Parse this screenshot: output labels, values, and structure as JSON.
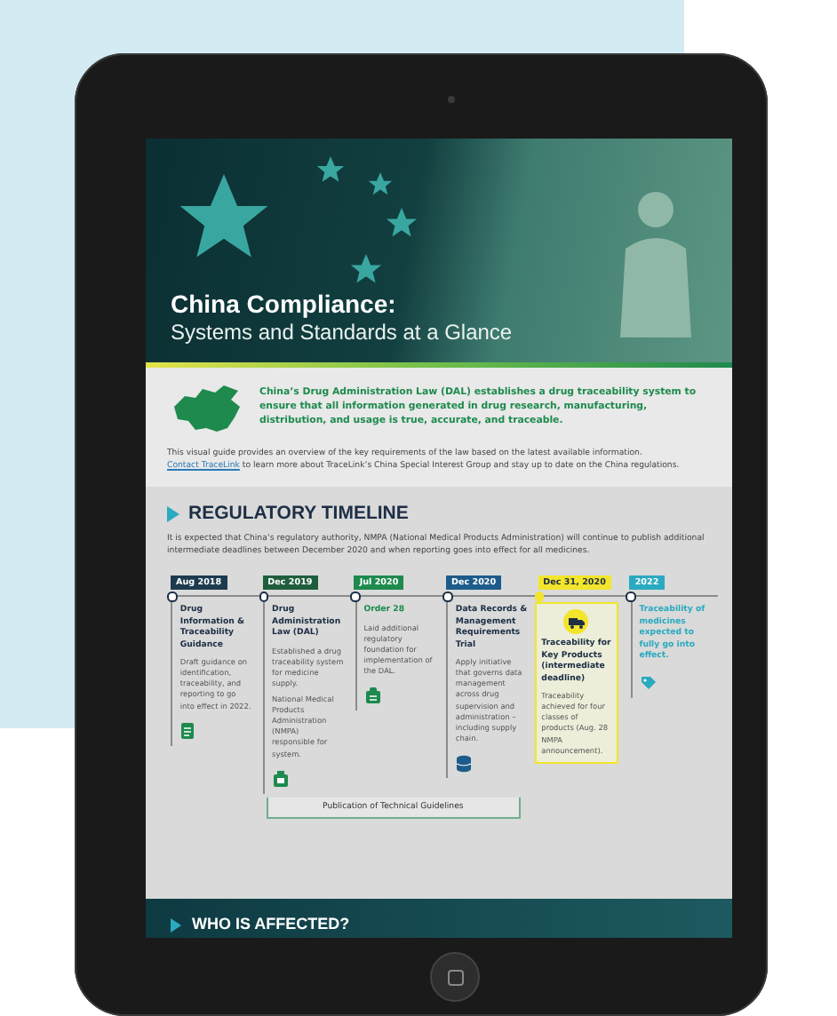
{
  "hero": {
    "title": "China Compliance:",
    "subtitle": "Systems and Standards at a Glance"
  },
  "intro": {
    "lead": "China’s Drug Administration Law (DAL) establishes a drug traceability system to ensure that all information generated in drug research, manufacturing, distribution, and usage is true, accurate, and traceable.",
    "text_before": "This visual guide provides an overview of the key requirements of the law based on the latest available information.",
    "link": "Contact TraceLink",
    "text_after": "to learn more about TraceLink’s China Special Interest Group and stay up to date on the China regulations."
  },
  "timeline": {
    "heading": "REGULATORY TIMELINE",
    "description": "It is expected that China’s regulatory authority, NMPA (National Medical Products Administration) will continue to publish additional intermediate deadlines between December 2020 and when reporting goes into effect for all medicines.",
    "milestones": [
      {
        "date": "Aug 2018",
        "color": "#1d3b4f",
        "kind": "standard",
        "title": "Drug Information & Traceability Guidance",
        "details": [
          "Draft guidance on identification, traceability, and reporting to go into effect in 2022."
        ]
      },
      {
        "date": "Dec 2019",
        "color": "#1f5e3c",
        "kind": "standard",
        "title": "Drug Administration Law (DAL)",
        "details": [
          "Established a drug traceability system for medicine supply.",
          "National Medical Products Administration (NMPA) responsible for system."
        ]
      },
      {
        "date": "Jul 2020",
        "color": "#1e8a4e",
        "kind": "accent",
        "title": "Order 28",
        "details": [
          "Laid additional regulatory foundation for implementation of the DAL."
        ]
      },
      {
        "date": "Dec 2020",
        "color": "#1d5c8a",
        "kind": "standard",
        "title": "Data Records & Management Requirements Trial",
        "details": [
          "Apply initiative that governs data management across drug supervision and administration – including supply chain."
        ]
      },
      {
        "date": "Dec 31, 2020",
        "color": "#f2e52b",
        "kind": "highlight",
        "title": "Traceability for Key Products (intermediate deadline)",
        "details": [
          "Traceability achieved for four classes of products (Aug. 28 NMPA announcement)."
        ]
      },
      {
        "date": "2022",
        "color": "#2aaac0",
        "kind": "accent",
        "title": "Traceability of medicines expected to fully go into effect."
      }
    ],
    "bracket": "Publication of Technical Guidelines"
  },
  "next_section": {
    "heading": "WHO IS AFFECTED?"
  }
}
